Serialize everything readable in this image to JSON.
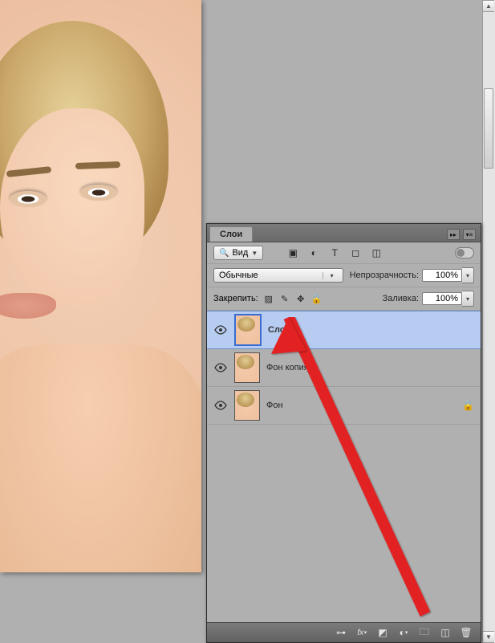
{
  "panel": {
    "tab_label": "Слои",
    "filter_label": "Вид",
    "blend_mode": "Обычные",
    "opacity_label": "Непрозрачность:",
    "opacity_value": "100%",
    "fill_label": "Заливка:",
    "fill_value": "100%",
    "lock_label": "Закрепить:"
  },
  "layers": [
    {
      "name": "Слой 1",
      "active": true,
      "locked": false
    },
    {
      "name": "Фон копия",
      "active": false,
      "locked": false
    },
    {
      "name": "Фон",
      "active": false,
      "locked": true
    }
  ],
  "filter_icons": [
    "image-icon",
    "adjust-icon",
    "type-icon",
    "shape-icon",
    "smart-icon"
  ],
  "lock_icons": [
    "transparency-lock",
    "brush-lock",
    "move-lock",
    "all-lock"
  ],
  "footer_icons": [
    "link-icon",
    "fx-icon",
    "mask-icon",
    "adjustment-icon",
    "group-icon",
    "new-layer-icon",
    "trash-icon"
  ]
}
